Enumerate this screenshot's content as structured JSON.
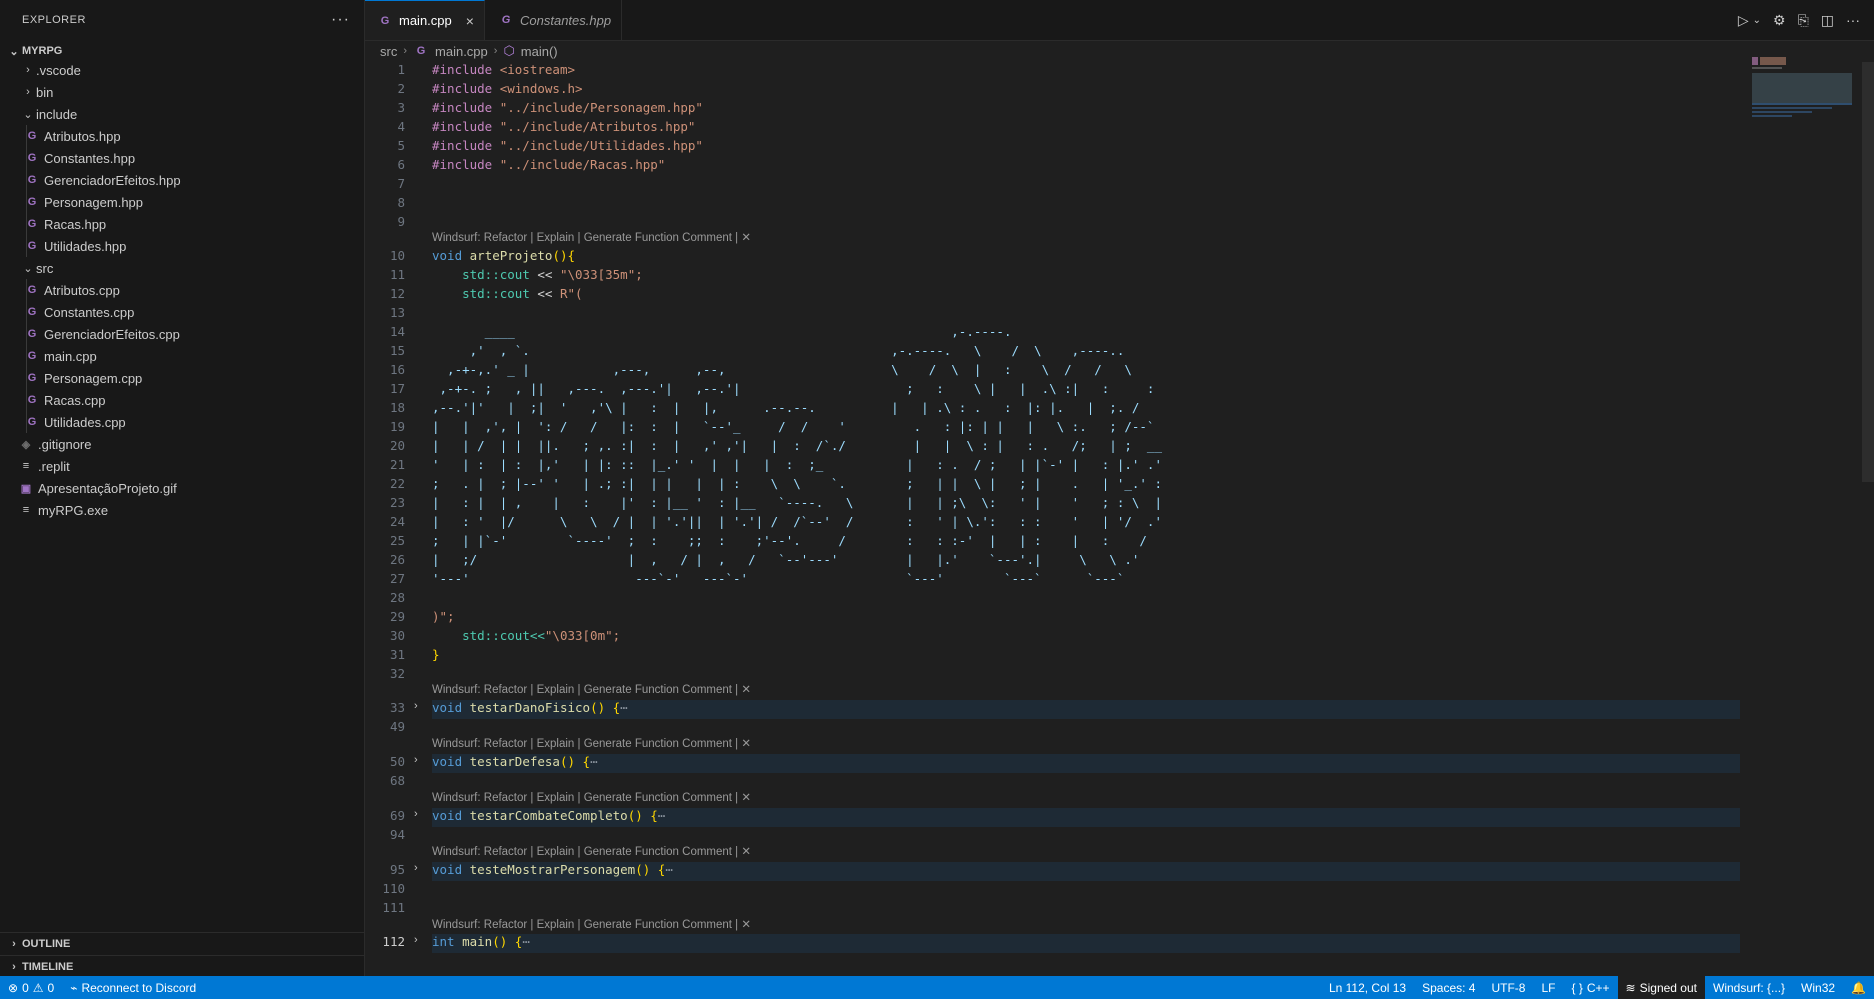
{
  "sidebar": {
    "title": "EXPLORER",
    "more_icon": "ellipsis-icon",
    "project": "MYRPG",
    "items": [
      {
        "label": ".vscode",
        "type": "folder",
        "expanded": false
      },
      {
        "label": "bin",
        "type": "folder",
        "expanded": false
      },
      {
        "label": "include",
        "type": "folder",
        "expanded": true
      },
      {
        "label": "Atributos.hpp",
        "type": "cpp"
      },
      {
        "label": "Constantes.hpp",
        "type": "cpp"
      },
      {
        "label": "GerenciadorEfeitos.hpp",
        "type": "cpp"
      },
      {
        "label": "Personagem.hpp",
        "type": "cpp"
      },
      {
        "label": "Racas.hpp",
        "type": "cpp"
      },
      {
        "label": "Utilidades.hpp",
        "type": "cpp"
      },
      {
        "label": "src",
        "type": "folder",
        "expanded": true
      },
      {
        "label": "Atributos.cpp",
        "type": "cpp"
      },
      {
        "label": "Constantes.cpp",
        "type": "cpp"
      },
      {
        "label": "GerenciadorEfeitos.cpp",
        "type": "cpp"
      },
      {
        "label": "main.cpp",
        "type": "cpp"
      },
      {
        "label": "Personagem.cpp",
        "type": "cpp"
      },
      {
        "label": "Racas.cpp",
        "type": "cpp"
      },
      {
        "label": "Utilidades.cpp",
        "type": "cpp"
      },
      {
        "label": ".gitignore",
        "type": "git"
      },
      {
        "label": ".replit",
        "type": "plain"
      },
      {
        "label": "ApresentaçãoProjeto.gif",
        "type": "gif"
      },
      {
        "label": "myRPG.exe",
        "type": "plain"
      }
    ],
    "outline": "OUTLINE",
    "timeline": "TIMELINE"
  },
  "tabs": [
    {
      "label": "main.cpp",
      "active": true,
      "close": "×"
    },
    {
      "label": "Constantes.hpp",
      "active": false
    }
  ],
  "breadcrumb": {
    "folder": "src",
    "file": "main.cpp",
    "symbol": "main()"
  },
  "editor": {
    "codelens": "Windsurf: Refactor | Explain | Generate Function Comment | ✕",
    "lines": {
      "1": "#include <iostream>",
      "2": "#include <windows.h>",
      "3": "#include \"../include/Personagem.hpp\"",
      "4": "#include \"../include/Atributos.hpp\"",
      "5": "#include \"../include/Utilidades.hpp\"",
      "6": "#include \"../include/Racas.hpp\"",
      "10_kw": "void",
      "10_fn": "arteProjeto",
      "10_rest": "(){",
      "11_ns": "std::cout",
      "11_rest": "<<",
      "11_str": "\"\\033[35m\";",
      "12_ns": "std::cout",
      "12_rest": "<<",
      "12_str": "R\"(",
      "29": ")\";",
      "30_ns": "std::cout<<",
      "30_str": "\"\\033[0m\";",
      "31": "}",
      "33_kw": "void",
      "33_fn": "testarDanoFisico",
      "33_rest": "() {",
      "50_kw": "void",
      "50_fn": "testarDefesa",
      "50_rest": "() {",
      "69_kw": "void",
      "69_fn": "testarCombateCompleto",
      "69_rest": "() {",
      "95_kw": "void",
      "95_fn": "testeMostrarPersonagem",
      "95_rest": "() {",
      "112_kw": "int",
      "112_fn": "main",
      "112_rest": "() {",
      "ellipsis": "⋯"
    },
    "ascii_art": [
      "       ____                                                          ,-.----.",
      "     ,'  , `.                                                ,-.----.   \\    /  \\    ,----..",
      "  ,-+-,.' _ |           ,---,      ,--,                      \\    /  \\  |   :    \\  /   /   \\",
      " ,-+-. ;   , ||   ,---.  ,---.'|   ,--.'|                      ;   :    \\ |   |  .\\ :|   :     :",
      ",--.'|'   |  ;|  '   ,'\\ |   :  |   |,      .--.--.          |   | .\\ : .   :  |: |.   |  ;. /",
      "|   |  ,', |  ': /   /   |:  :  |   `--'_     /  /    '         .   : |: | |   |   \\ :.   ; /--`",
      "|   | /  | |  ||.   ; ,. :|  :  |   ,' ,'|   |  :  /`./         |   |  \\ : |   : .   /;   | ;  __",
      "'   | :  | :  |,'   | |: ::  |_.' '  |  |   |  :  ;_           |   : .  / ;   | |`-' |   : |.' .'",
      ";   . |  ; |--' '   | .; :|  | |   |  | :    \\  \\    `.        ;   | |  \\ |   ; |    .   | '_.' :",
      "|   : |  | ,    |   :    |'  : |__ '  : |__   `----.   \\       |   | ;\\  \\:   ' |    '   ; : \\  |",
      "|   : '  |/      \\   \\  / |  | '.'||  | '.'| /  /`--'  /       :   ' | \\.':   : :    '   | '/  .'",
      ";   | |`-'        `----'  ;  :    ;;  :    ;'--'.     /        :   : :-'  |   | :    |   :    /",
      "|   ;/                    |  ,   / |  ,   /   `--'---'         |   |.'    `---'.|     \\   \\ .'",
      "'---'                      ---`-'   ---`-'                     `---'        `---`      `---`"
    ]
  },
  "statusbar": {
    "errors": "0",
    "warnings": "0",
    "discord": "Reconnect to Discord",
    "cursor": "Ln 112, Col 13",
    "spaces": "Spaces: 4",
    "encoding": "UTF-8",
    "eol": "LF",
    "language": "C++",
    "signed": "Signed out",
    "windsurf": "Windsurf: {...}",
    "platform": "Win32"
  }
}
